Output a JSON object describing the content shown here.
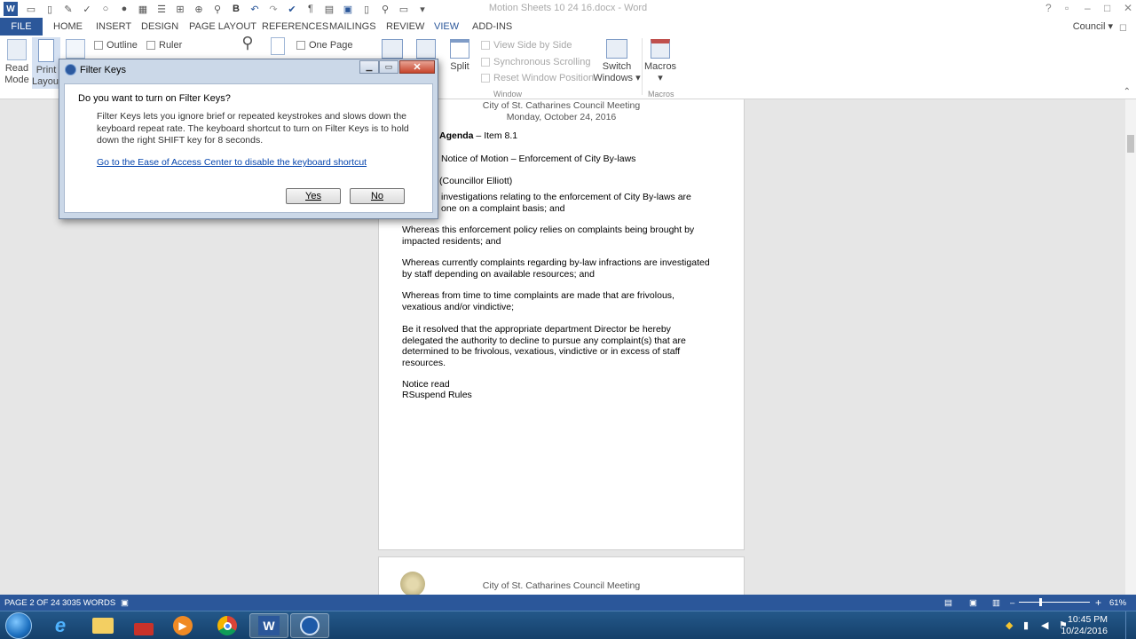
{
  "app": {
    "doc_title": "Motion Sheets 10 24 16.docx - Word",
    "account": "Council",
    "help_icon": "?"
  },
  "ribbon_tabs": {
    "file": "FILE",
    "tabs": [
      "HOME",
      "INSERT",
      "DESIGN",
      "PAGE LAYOUT",
      "REFERENCES",
      "MAILINGS",
      "REVIEW",
      "VIEW",
      "ADD-INS"
    ],
    "active": "VIEW"
  },
  "ribbon": {
    "read_mode": "Read Mode",
    "read_mode_l1": "Read",
    "read_mode_l2": "Mode",
    "print_layout_l1": "Print",
    "print_layout_l2": "Layout",
    "outline": "Outline",
    "ruler": "Ruler",
    "one_page": "One Page",
    "split": "Split",
    "view_side_by_side": "View Side by Side",
    "synchronous_scrolling": "Synchronous Scrolling",
    "reset_window_position": "Reset Window Position",
    "window_group": "Window",
    "switch_windows_l1": "Switch",
    "switch_windows_l2": "Windows",
    "macros": "Macros",
    "macros_group": "Macros"
  },
  "document": {
    "page1": {
      "header_line1": "City of St. Catharines Council Meeting",
      "header_line2": "Monday, October 24, 2016",
      "agenda_bold": "Agenda",
      "agenda_rest": " – Item 8.1",
      "notice": "Notice of Motion – Enforcement of City By-laws",
      "mover": "(Councillor Elliott)",
      "para1_l1": "investigations relating to the enforcement of City By-laws are",
      "para1_l2": "one on a complaint basis; and",
      "para2_l1": "Whereas this enforcement policy relies on complaints being brought by",
      "para2_l2": "impacted residents; and",
      "para3_l1": "Whereas currently complaints regarding by-law infractions are investigated",
      "para3_l2": "by staff depending on available resources; and",
      "para4_l1": "Whereas from time to time complaints are made that are frivolous,",
      "para4_l2": "vexatious and/or vindictive;",
      "para5_l1": "Be it resolved that the appropriate department Director be hereby",
      "para5_l2": "delegated the authority to decline to pursue any complaint(s) that are",
      "para5_l3": "determined to be frivolous, vexatious, vindictive or in excess of staff",
      "para5_l4": "resources.",
      "notice_read": "Notice read",
      "suspend": "RSuspend Rules"
    },
    "page2": {
      "header_line1": "City of St. Catharines Council Meeting"
    }
  },
  "dialog": {
    "title": "Filter Keys",
    "question": "Do you want to turn on Filter Keys?",
    "description": "Filter Keys lets you ignore brief or repeated keystrokes and slows down the keyboard repeat rate.  The keyboard shortcut to turn on Filter Keys is to hold down the right SHIFT key for 8 seconds.",
    "link": "Go to the Ease of Access Center to disable the keyboard shortcut",
    "yes": "Yes",
    "no": "No"
  },
  "statusbar": {
    "page": "PAGE 2 OF 24",
    "words": "3035 WORDS",
    "zoom": "61%"
  },
  "taskbar": {
    "time": "10:45 PM",
    "date": "10/24/2016"
  },
  "colors": {
    "word_blue": "#2b579a",
    "taskbar": "#1c4b7a",
    "link": "#0645ad"
  }
}
